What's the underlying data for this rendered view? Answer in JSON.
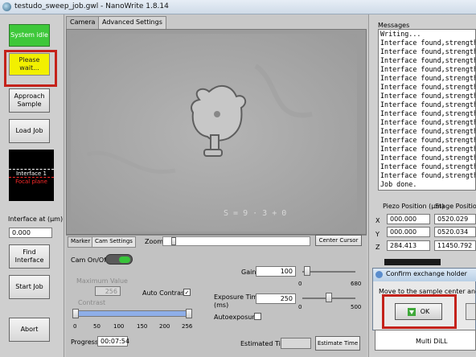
{
  "window": {
    "title": "testudo_sweep_job.gwl - NanoWrite 1.8.14"
  },
  "left": {
    "system_idle": "System idle",
    "please_wait": "Please wait...",
    "approach_sample": "Approach Sample",
    "load_job": "Load Job",
    "focal_interface": "Interface 1",
    "focal_plane": "Focal plane",
    "interface_label": "Interface at (µm)",
    "interface_value": "0.000",
    "find_interface": "Find Interface",
    "start_job": "Start Job",
    "abort": "Abort"
  },
  "tabs": {
    "camera": "Camera",
    "advanced": "Advanced Settings"
  },
  "camera_overlay": "S = 9 · 3 + 0",
  "controls": {
    "marker_tab": "Marker",
    "cam_settings_tab": "Cam Settings",
    "zoom_label": "Zoom",
    "center_cursor": "Center Cursor",
    "cam_onoff": "Cam On/Off",
    "max_value_label": "Maximum Value",
    "max_value": "256",
    "auto_contrast": "Auto Contrast",
    "auto_contrast_checked": "✓",
    "contrast_label": "Contrast",
    "gain_label": "Gain",
    "gain_value": "100",
    "gain_min": "0",
    "gain_max": "680",
    "exposure_label": "Exposure Time",
    "exposure_unit": "(ms)",
    "exposure_value": "250",
    "exposure_min": "0",
    "exposure_max": "500",
    "autoexposure": "Autoexposure",
    "contrast_ticks": [
      "0",
      "50",
      "100",
      "150",
      "200",
      "256"
    ],
    "progress_label": "Progress",
    "progress_value": "00:07:54",
    "estimated_time_label": "Estimated Time",
    "estimated_time_value": "",
    "estimate_time_button": "Estimate Time"
  },
  "right": {
    "messages_label": "Messages",
    "messages": [
      "Writing...",
      "Interface found,strength:",
      "Interface found,strength:",
      "Interface found,strength:",
      "Interface found,strength:",
      "Interface found,strength:",
      "Interface found,strength:",
      "Interface found,strength:",
      "Interface found,strength:",
      "Interface found,strength:",
      "Interface found,strength:",
      "Interface found,strength:",
      "Interface found,strength:",
      "Interface found,strength:",
      "Interface found,strength:",
      "Interface found,strength:",
      "Interface found,strength:",
      "Job done."
    ],
    "piezo_label": "Piezo Position (µm)",
    "stage_label": "Stage Position",
    "axes": [
      "X",
      "Y",
      "Z"
    ],
    "piezo": [
      "000.000",
      "000.000",
      "284.413"
    ],
    "stage": [
      "0520.029",
      "0520.034",
      "11450.792"
    ],
    "multi_dill": "Multi DiLL"
  },
  "dialog": {
    "title": "Confirm exchange holder",
    "message": "Move to the sample center and ...",
    "ok": "OK"
  },
  "colors": {
    "idle": "#3ec83a",
    "wait": "#f2f000",
    "highlight": "#c4221a",
    "contrast_bar": "#8eaee8"
  }
}
